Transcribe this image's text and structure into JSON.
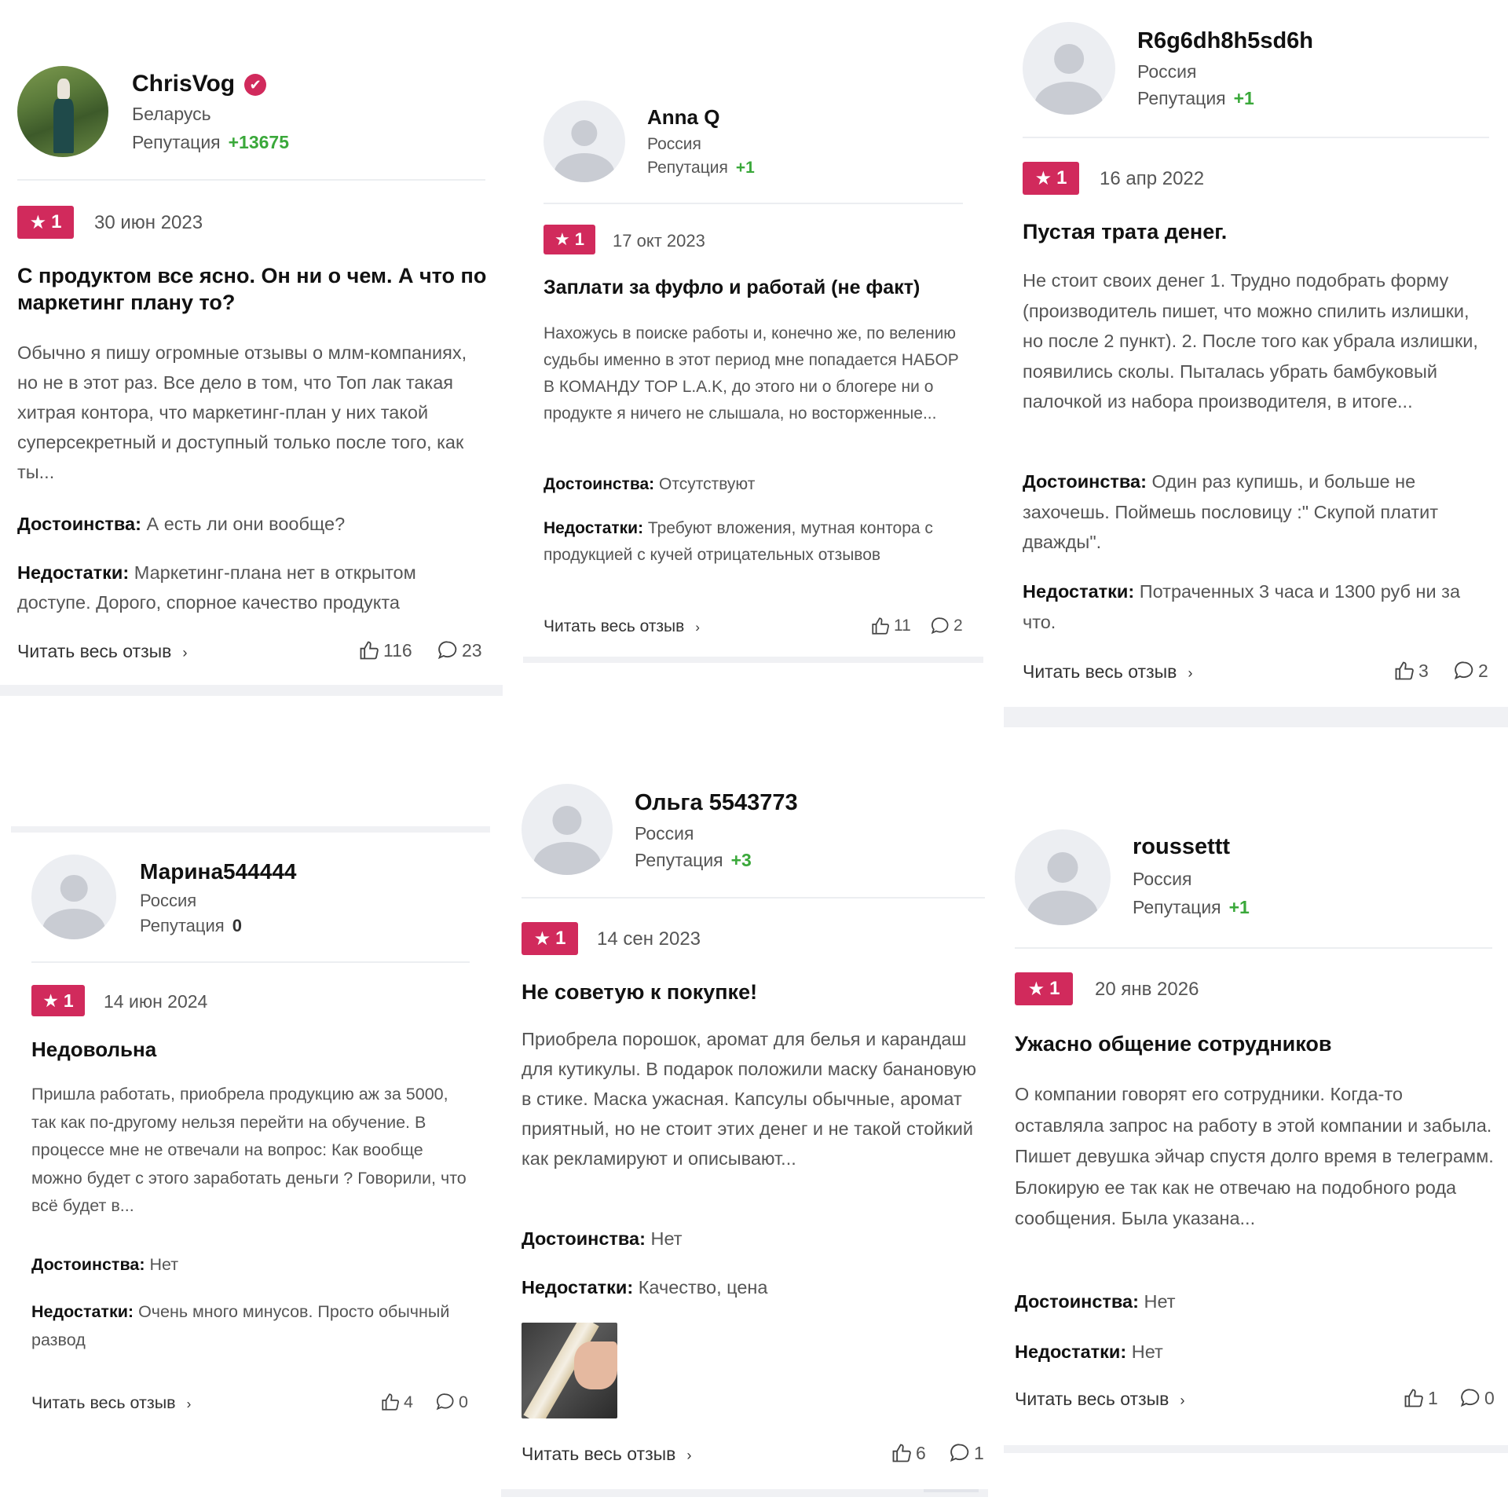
{
  "labels": {
    "reputation": "Репутация",
    "pros": "Достоинства:",
    "cons": "Недостатки:",
    "read_more": "Читать весь отзыв",
    "read_more_chevron": "›"
  },
  "reviews": [
    {
      "username": "ChrisVog",
      "verified": true,
      "country": "Беларусь",
      "reputation": "+13675",
      "rating": "1",
      "date": "30 июн 2023",
      "title": "С продуктом все ясно. Он ни о чем. А что по маркетинг плану то?",
      "text": "Обычно я пишу огромные отзывы о млм-компаниях, но не в этот раз. Все дело в том, что Топ лак такая хитрая контора, что маркетинг-план у них такой суперсекретный и доступный только после того, как ты...",
      "pros": "А есть ли они вообще?",
      "cons": "Маркетинг-плана нет в открытом доступе. Дорого, спорное качество продукта",
      "likes": "116",
      "comments": "23"
    },
    {
      "username": "Anna Q",
      "verified": false,
      "country": "Россия",
      "reputation": "+1",
      "rating": "1",
      "date": "17 окт 2023",
      "title": "Заплати за фуфло и работай (не факт)",
      "text": "Нахожусь в поиске работы и, конечно же, по велению судьбы именно в этот период мне попадается НАБОР В КОМАНДУ TOP L.A.K, до этого ни о блогере ни о продукте я ничего не слышала, но восторженные...",
      "pros": "Отсутствуют",
      "cons": "Требуют вложения, мутная контора с продукцией с кучей отрицательных отзывов",
      "likes": "11",
      "comments": "2"
    },
    {
      "username": "R6g6dh8h5sd6h",
      "verified": false,
      "country": "Россия",
      "reputation": "+1",
      "rating": "1",
      "date": "16 апр 2022",
      "title": "Пустая трата денег.",
      "text": "Не стоит своих денег 1. Трудно подобрать форму (производитель пишет, что можно спилить излишки, но после 2 пункт). 2. После того как убрала излишки, появились сколы. Пыталась убрать бамбуковый палочкой из набора производителя, в итоге...",
      "pros": "Один раз купишь, и больше не захочешь. Поймешь пословицу :\" Скупой платит дважды\".",
      "cons": "Потраченных 3 часа и 1300 руб ни за что.",
      "likes": "3",
      "comments": "2"
    },
    {
      "username": "Марина544444",
      "verified": false,
      "country": "Россия",
      "reputation": "0",
      "rating": "1",
      "date": "14 июн 2024",
      "title": "Недовольна",
      "text": "Пришла работать, приобрела продукцию аж за 5000, так как по-другому нельзя перейти на обучение. В процессе мне не отвечали на вопрос: Как вообще можно будет с этого заработать деньги ? Говорили, что всё будет в...",
      "pros": "Нет",
      "cons": "Очень много минусов. Просто обычный развод",
      "likes": "4",
      "comments": "0"
    },
    {
      "username": "Ольга 5543773",
      "verified": false,
      "country": "Россия",
      "reputation": "+3",
      "rating": "1",
      "date": "14 сен 2023",
      "title": "Не советую к покупке!",
      "text": "Приобрела порошок, аромат для белья и карандаш для кутикулы. В подарок положили маску банановую в стике. Маска ужасная. Капсулы обычные, аромат приятный, но не стоит этих денег и не такой стойкий как рекламируют и описывают...",
      "pros": "Нет",
      "cons": "Качество, цена",
      "likes": "6",
      "comments": "1"
    },
    {
      "username": "roussettt",
      "verified": false,
      "country": "Россия",
      "reputation": "+1",
      "rating": "1",
      "date": "20 янв 2026",
      "title": "Ужасно общение сотрудников",
      "text": "О компании говорят его сотрудники. Когда-то оставляла запрос на работу в этой компании и забыла. Пишет девушка эйчар спустя долго время в телеграмм. Блокирую ее так как не отвечаю на подобного рода сообщения. Была указана...",
      "pros": "Нет",
      "cons": "Нет",
      "likes": "1",
      "comments": "0"
    }
  ],
  "colors": {
    "accent": "#d12a5c",
    "reputation_positive": "#3aa83a",
    "divider": "#eceef1",
    "separator_bar": "#f0f1f4"
  }
}
